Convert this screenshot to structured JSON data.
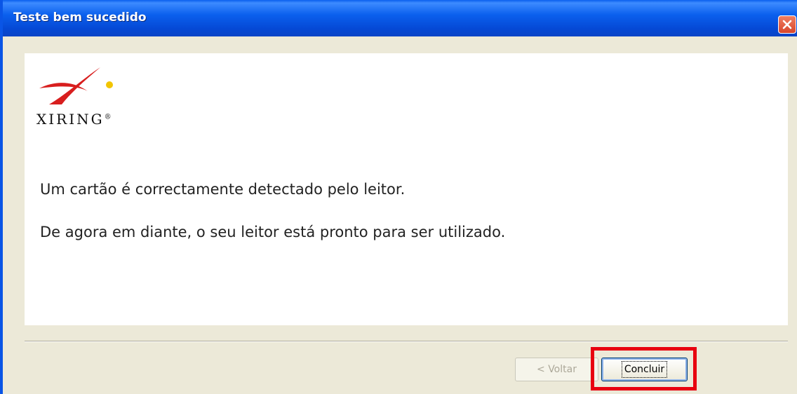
{
  "window": {
    "title": "Teste bem sucedido"
  },
  "logo": {
    "brand": "XIRING",
    "trademark": "®"
  },
  "messages": {
    "line1": "Um cartão é correctamente detectado pelo leitor.",
    "line2": "De agora em diante, o seu leitor está pronto para ser utilizado."
  },
  "buttons": {
    "back_label": "< Voltar",
    "back_enabled": false,
    "finish_label": "Concluir"
  },
  "colors": {
    "titlebar": "#0a5fee",
    "highlight": "#e8000f",
    "logo_red": "#d81e1e",
    "logo_yellow": "#f2c500"
  },
  "icons": {
    "close": "close-icon"
  }
}
